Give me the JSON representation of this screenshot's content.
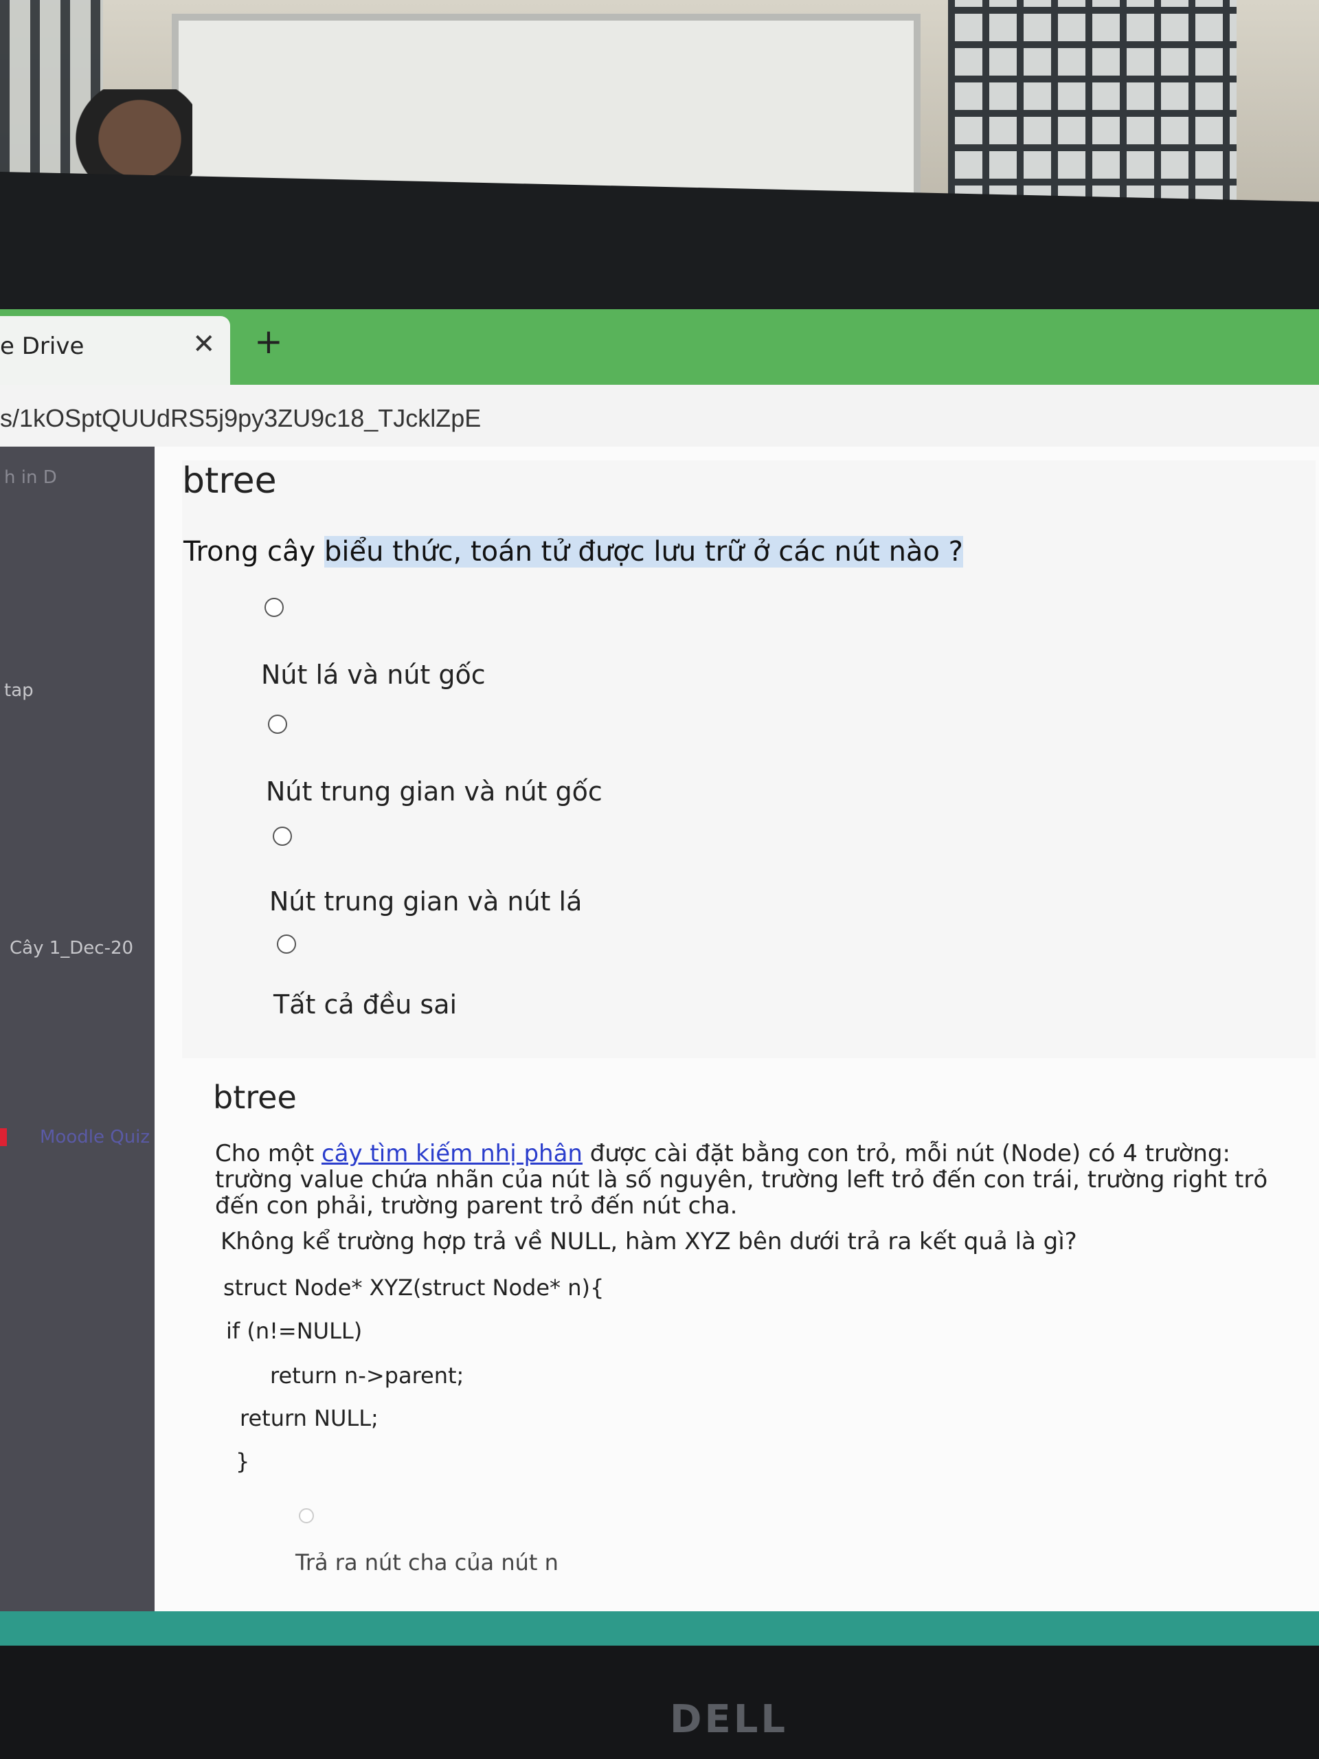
{
  "browser": {
    "tab_title": "e Drive",
    "tab_close": "✕",
    "new_tab": "+",
    "url": "s/1kOSptQUUdRS5j9py3ZU9c18_TJcklZpE"
  },
  "sidebar": {
    "items": [
      "h in D",
      "tap",
      "Cây 1_Dec-20",
      "Moodle Quiz"
    ]
  },
  "question1": {
    "title": "btree",
    "text_before": "Trong cây ",
    "text_highlight": "biểu thức, toán tử được lưu trữ ở các nút nào ?",
    "options": [
      "Nút lá và nút gốc",
      "Nút trung gian và nút gốc",
      "Nút trung gian và nút lá",
      "Tất cả đều sai"
    ]
  },
  "question2": {
    "title": "btree",
    "p1_before": "Cho một ",
    "p1_link": "cây tìm kiếm nhị phân",
    "p1_after": " được cài đặt bằng con trỏ, mỗi nút (Node) có 4 trường: trường value chứa nhãn của nút là số nguyên, trường left trỏ đến con trái, trường right trỏ đến con phải, trường parent trỏ đến nút cha.",
    "p2": "Không kể trường hợp trả về NULL, hàm XYZ bên dưới trả ra kết quả là gì?",
    "code": [
      "struct Node* XYZ(struct Node* n){",
      "if (n!=NULL)",
      "return n->parent;",
      "return NULL;",
      "}"
    ],
    "option1": "Trả ra nút cha của nút n"
  },
  "monitor": {
    "brand": "DELL"
  }
}
